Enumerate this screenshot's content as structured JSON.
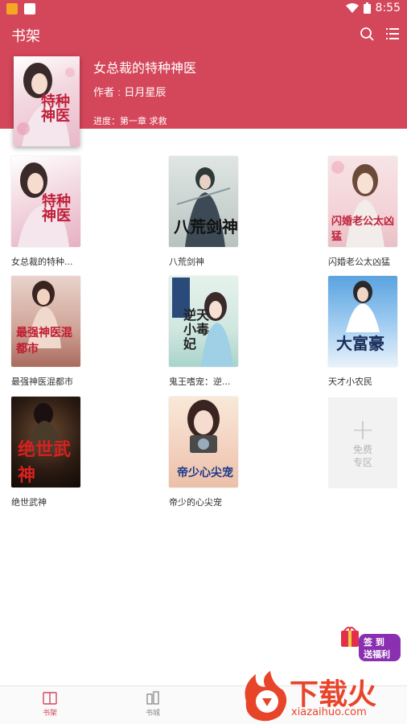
{
  "status_bar": {
    "time": "8:55"
  },
  "app_bar": {
    "title": "书架",
    "search_icon": "search-icon",
    "menu_icon": "list-menu-icon"
  },
  "current_book": {
    "title": "女总裁的特种神医",
    "author_label": "作者",
    "author": "日月星辰",
    "progress": "进度：第一章 求救",
    "cover_text": "特种神医"
  },
  "books": [
    {
      "title": "女总裁的特种...",
      "cover_text": "特种神医"
    },
    {
      "title": "八荒剑神",
      "cover_text": "八荒剑神"
    },
    {
      "title": "闪婚老公太凶猛",
      "cover_text": "闪婚老公太凶猛"
    },
    {
      "title": "最强神医混都市",
      "cover_text": "最强神医混都市"
    },
    {
      "title": "鬼王嗜宠：逆...",
      "cover_text": "逆天小毒妃"
    },
    {
      "title": "天才小农民",
      "cover_text": "大富豪"
    },
    {
      "title": "绝世武神",
      "cover_text": "绝世武神"
    },
    {
      "title": "帝少的心尖宠",
      "cover_text": "帝少心尖宠"
    }
  ],
  "free_zone": {
    "label": "免费专区"
  },
  "promo": {
    "line1": "签 到",
    "line2": "送福利"
  },
  "bottom_nav": [
    {
      "label": "书架",
      "icon": "bookshelf-icon",
      "active": true
    },
    {
      "label": "书城",
      "icon": "bookstore-icon",
      "active": false
    }
  ],
  "watermark": {
    "brand": "下载火",
    "url": "xiazaihuo.com"
  },
  "colors": {
    "primary": "#d4465a",
    "accent": "#e8442a"
  }
}
